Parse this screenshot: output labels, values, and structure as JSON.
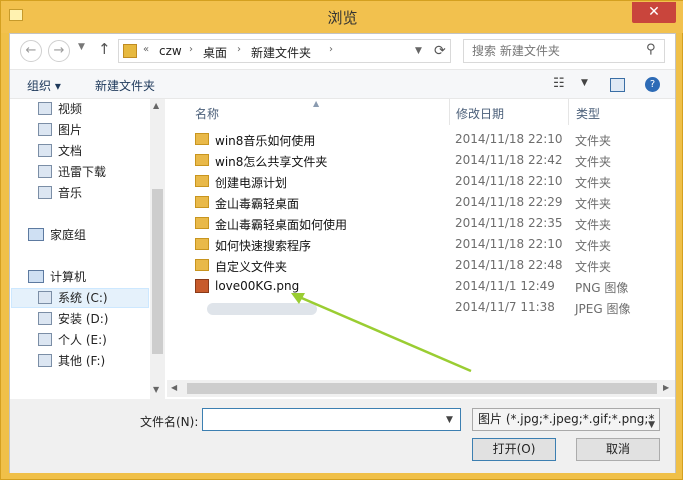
{
  "window": {
    "title": "浏览",
    "close_glyph": "✕"
  },
  "nav": {
    "back_glyph": "←",
    "forward_glyph": "→",
    "up_glyph": "↑",
    "breadcrumb": [
      "czw",
      "桌面",
      "新建文件夹"
    ],
    "prefix_glyph": "«",
    "sep_glyph": "›",
    "search_placeholder": "搜索 新建文件夹"
  },
  "toolbar": {
    "organize_label": "组织 ▾",
    "new_folder_label": "新建文件夹",
    "view_glyph": "☷",
    "help_glyph": "?"
  },
  "sidebar": {
    "items": [
      {
        "label": "视频",
        "icon": "video-icon"
      },
      {
        "label": "图片",
        "icon": "pictures-icon"
      },
      {
        "label": "文档",
        "icon": "documents-icon"
      },
      {
        "label": "迅雷下载",
        "icon": "download-icon"
      },
      {
        "label": "音乐",
        "icon": "music-icon"
      }
    ],
    "homegroup": "家庭组",
    "computer": "计算机",
    "drives": [
      {
        "label": "系统 (C:)",
        "selected": true
      },
      {
        "label": "安装 (D:)",
        "selected": false
      },
      {
        "label": "个人 (E:)",
        "selected": false
      },
      {
        "label": "其他 (F:)",
        "selected": false
      }
    ]
  },
  "columns": {
    "name": "名称",
    "date": "修改日期",
    "type": "类型"
  },
  "files": [
    {
      "name": "win8音乐如何使用",
      "date": "2014/11/18 22:10",
      "type": "文件夹",
      "kind": "folder"
    },
    {
      "name": "win8怎么共享文件夹",
      "date": "2014/11/18 22:42",
      "type": "文件夹",
      "kind": "folder"
    },
    {
      "name": "创建电源计划",
      "date": "2014/11/18 22:10",
      "type": "文件夹",
      "kind": "folder"
    },
    {
      "name": "金山毒霸轻桌面",
      "date": "2014/11/18 22:29",
      "type": "文件夹",
      "kind": "folder"
    },
    {
      "name": "金山毒霸轻桌面如何使用",
      "date": "2014/11/18 22:35",
      "type": "文件夹",
      "kind": "folder"
    },
    {
      "name": "如何快速搜索程序",
      "date": "2014/11/18 22:10",
      "type": "文件夹",
      "kind": "folder"
    },
    {
      "name": "自定义文件夹",
      "date": "2014/11/18 22:48",
      "type": "文件夹",
      "kind": "folder"
    },
    {
      "name": "love00KG.png",
      "date": "2014/11/1 12:49",
      "type": "PNG 图像",
      "kind": "image"
    },
    {
      "name": "",
      "date": "2014/11/7 11:38",
      "type": "JPEG 图像",
      "kind": "blurred"
    }
  ],
  "bottom": {
    "filename_label": "文件名(N):",
    "filename_value": "",
    "filter_text": "图片 (*.jpg;*.jpeg;*.gif;*.png;*",
    "open_label": "打开(O)",
    "cancel_label": "取消"
  },
  "colors": {
    "titlebar": "#f2c14e",
    "close": "#c9453c",
    "annotation_arrow": "#9acd32"
  }
}
